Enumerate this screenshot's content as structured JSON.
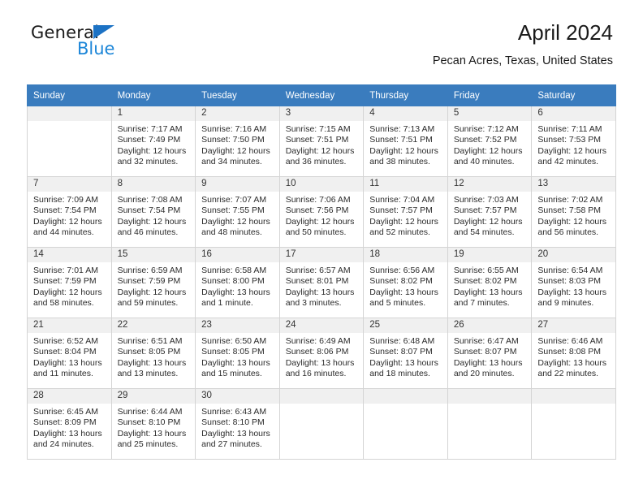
{
  "brand": {
    "name_top": "General",
    "name_bottom": "Blue",
    "accent_color": "#1c86d8",
    "triangle_color": "#1c72c4"
  },
  "header": {
    "title": "April 2024",
    "subtitle": "Pecan Acres, Texas, United States"
  },
  "theme": {
    "header_row_bg": "#3a7cbe",
    "daynum_bg": "#f0f0f0",
    "grid_border": "#d4d4d4"
  },
  "weekdays": [
    "Sunday",
    "Monday",
    "Tuesday",
    "Wednesday",
    "Thursday",
    "Friday",
    "Saturday"
  ],
  "weeks": [
    [
      {
        "day": "",
        "lines": []
      },
      {
        "day": "1",
        "lines": [
          "Sunrise: 7:17 AM",
          "Sunset: 7:49 PM",
          "Daylight: 12 hours",
          "and 32 minutes."
        ]
      },
      {
        "day": "2",
        "lines": [
          "Sunrise: 7:16 AM",
          "Sunset: 7:50 PM",
          "Daylight: 12 hours",
          "and 34 minutes."
        ]
      },
      {
        "day": "3",
        "lines": [
          "Sunrise: 7:15 AM",
          "Sunset: 7:51 PM",
          "Daylight: 12 hours",
          "and 36 minutes."
        ]
      },
      {
        "day": "4",
        "lines": [
          "Sunrise: 7:13 AM",
          "Sunset: 7:51 PM",
          "Daylight: 12 hours",
          "and 38 minutes."
        ]
      },
      {
        "day": "5",
        "lines": [
          "Sunrise: 7:12 AM",
          "Sunset: 7:52 PM",
          "Daylight: 12 hours",
          "and 40 minutes."
        ]
      },
      {
        "day": "6",
        "lines": [
          "Sunrise: 7:11 AM",
          "Sunset: 7:53 PM",
          "Daylight: 12 hours",
          "and 42 minutes."
        ]
      }
    ],
    [
      {
        "day": "7",
        "lines": [
          "Sunrise: 7:09 AM",
          "Sunset: 7:54 PM",
          "Daylight: 12 hours",
          "and 44 minutes."
        ]
      },
      {
        "day": "8",
        "lines": [
          "Sunrise: 7:08 AM",
          "Sunset: 7:54 PM",
          "Daylight: 12 hours",
          "and 46 minutes."
        ]
      },
      {
        "day": "9",
        "lines": [
          "Sunrise: 7:07 AM",
          "Sunset: 7:55 PM",
          "Daylight: 12 hours",
          "and 48 minutes."
        ]
      },
      {
        "day": "10",
        "lines": [
          "Sunrise: 7:06 AM",
          "Sunset: 7:56 PM",
          "Daylight: 12 hours",
          "and 50 minutes."
        ]
      },
      {
        "day": "11",
        "lines": [
          "Sunrise: 7:04 AM",
          "Sunset: 7:57 PM",
          "Daylight: 12 hours",
          "and 52 minutes."
        ]
      },
      {
        "day": "12",
        "lines": [
          "Sunrise: 7:03 AM",
          "Sunset: 7:57 PM",
          "Daylight: 12 hours",
          "and 54 minutes."
        ]
      },
      {
        "day": "13",
        "lines": [
          "Sunrise: 7:02 AM",
          "Sunset: 7:58 PM",
          "Daylight: 12 hours",
          "and 56 minutes."
        ]
      }
    ],
    [
      {
        "day": "14",
        "lines": [
          "Sunrise: 7:01 AM",
          "Sunset: 7:59 PM",
          "Daylight: 12 hours",
          "and 58 minutes."
        ]
      },
      {
        "day": "15",
        "lines": [
          "Sunrise: 6:59 AM",
          "Sunset: 7:59 PM",
          "Daylight: 12 hours",
          "and 59 minutes."
        ]
      },
      {
        "day": "16",
        "lines": [
          "Sunrise: 6:58 AM",
          "Sunset: 8:00 PM",
          "Daylight: 13 hours",
          "and 1 minute."
        ]
      },
      {
        "day": "17",
        "lines": [
          "Sunrise: 6:57 AM",
          "Sunset: 8:01 PM",
          "Daylight: 13 hours",
          "and 3 minutes."
        ]
      },
      {
        "day": "18",
        "lines": [
          "Sunrise: 6:56 AM",
          "Sunset: 8:02 PM",
          "Daylight: 13 hours",
          "and 5 minutes."
        ]
      },
      {
        "day": "19",
        "lines": [
          "Sunrise: 6:55 AM",
          "Sunset: 8:02 PM",
          "Daylight: 13 hours",
          "and 7 minutes."
        ]
      },
      {
        "day": "20",
        "lines": [
          "Sunrise: 6:54 AM",
          "Sunset: 8:03 PM",
          "Daylight: 13 hours",
          "and 9 minutes."
        ]
      }
    ],
    [
      {
        "day": "21",
        "lines": [
          "Sunrise: 6:52 AM",
          "Sunset: 8:04 PM",
          "Daylight: 13 hours",
          "and 11 minutes."
        ]
      },
      {
        "day": "22",
        "lines": [
          "Sunrise: 6:51 AM",
          "Sunset: 8:05 PM",
          "Daylight: 13 hours",
          "and 13 minutes."
        ]
      },
      {
        "day": "23",
        "lines": [
          "Sunrise: 6:50 AM",
          "Sunset: 8:05 PM",
          "Daylight: 13 hours",
          "and 15 minutes."
        ]
      },
      {
        "day": "24",
        "lines": [
          "Sunrise: 6:49 AM",
          "Sunset: 8:06 PM",
          "Daylight: 13 hours",
          "and 16 minutes."
        ]
      },
      {
        "day": "25",
        "lines": [
          "Sunrise: 6:48 AM",
          "Sunset: 8:07 PM",
          "Daylight: 13 hours",
          "and 18 minutes."
        ]
      },
      {
        "day": "26",
        "lines": [
          "Sunrise: 6:47 AM",
          "Sunset: 8:07 PM",
          "Daylight: 13 hours",
          "and 20 minutes."
        ]
      },
      {
        "day": "27",
        "lines": [
          "Sunrise: 6:46 AM",
          "Sunset: 8:08 PM",
          "Daylight: 13 hours",
          "and 22 minutes."
        ]
      }
    ],
    [
      {
        "day": "28",
        "lines": [
          "Sunrise: 6:45 AM",
          "Sunset: 8:09 PM",
          "Daylight: 13 hours",
          "and 24 minutes."
        ]
      },
      {
        "day": "29",
        "lines": [
          "Sunrise: 6:44 AM",
          "Sunset: 8:10 PM",
          "Daylight: 13 hours",
          "and 25 minutes."
        ]
      },
      {
        "day": "30",
        "lines": [
          "Sunrise: 6:43 AM",
          "Sunset: 8:10 PM",
          "Daylight: 13 hours",
          "and 27 minutes."
        ]
      },
      {
        "day": "",
        "lines": []
      },
      {
        "day": "",
        "lines": []
      },
      {
        "day": "",
        "lines": []
      },
      {
        "day": "",
        "lines": []
      }
    ]
  ]
}
